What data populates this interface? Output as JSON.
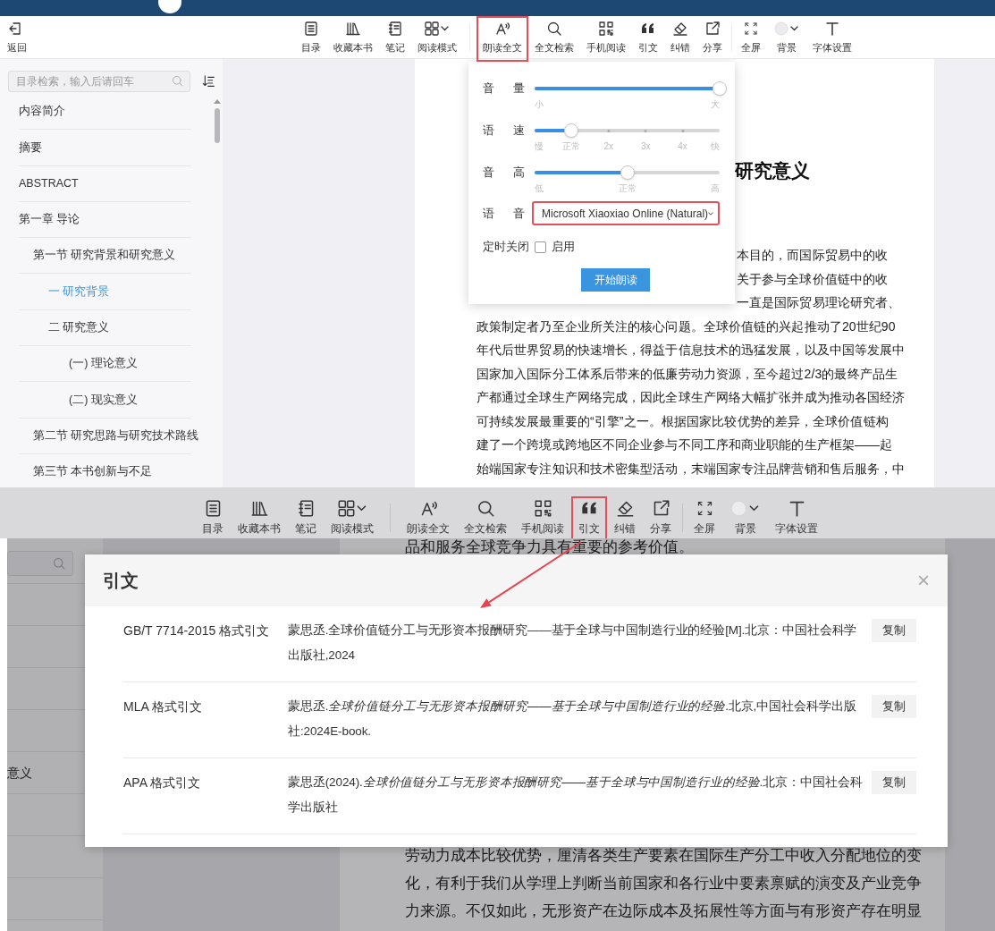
{
  "top_view": {
    "back_button": {
      "label": "返回"
    },
    "toolbar": {
      "groups": [
        [
          {
            "label": "目录",
            "highlighted": false
          },
          {
            "label": "收藏本书",
            "highlighted": false
          },
          {
            "label": "笔记",
            "highlighted": false
          },
          {
            "label": "阅读模式",
            "highlighted": false
          }
        ],
        [
          {
            "label": "朗读全文",
            "highlighted": true
          },
          {
            "label": "全文检索",
            "highlighted": false
          },
          {
            "label": "手机阅读",
            "highlighted": false
          },
          {
            "label": "引文",
            "highlighted": false
          },
          {
            "label": "纠错",
            "highlighted": false
          },
          {
            "label": "分享",
            "highlighted": false
          }
        ],
        [
          {
            "label": "全屏",
            "highlighted": false
          },
          {
            "label": "背景",
            "highlighted": false
          },
          {
            "label": "字体设置",
            "highlighted": false
          }
        ]
      ]
    },
    "toc_search": {
      "placeholder": "目录检索，输入后请回车"
    },
    "toc": [
      {
        "label": "内容简介",
        "selected": false
      },
      {
        "label": "摘要",
        "selected": false
      },
      {
        "label": "ABSTRACT",
        "selected": false
      },
      {
        "label": "第一章 导论",
        "selected": false,
        "children": [
          {
            "label": "第一节 研究背景和研究意义",
            "selected": false,
            "children": [
              {
                "label": "一 研究背景",
                "selected": true
              },
              {
                "label": "二 研究意义",
                "selected": false,
                "children": [
                  {
                    "label": "(一) 理论意义",
                    "selected": false
                  },
                  {
                    "label": "(二) 现实意义",
                    "selected": false
                  }
                ]
              }
            ]
          },
          {
            "label": "第二节 研究思路与研究技术路线",
            "selected": false
          },
          {
            "label": "第三节 本书创新与不足",
            "selected": false
          }
        ]
      }
    ],
    "page": {
      "heading": "研究意义",
      "line_fragments": [
        "本目的，而国际贸易中的收",
        "关于参与全球价值链中的收",
        "一直是国际贸易理论研究者、"
      ],
      "lines": [
        "政策制定者乃至企业所关注的核心问题。全球价值链的兴起推动了20世纪90",
        "年代后世界贸易的快速增长，得益于信息技术的迅猛发展，以及中国等发展中",
        "国家加入国际分工体系后带来的低廉劳动力资源，至今超过2/3的最终产品生",
        "产都通过全球生产网络完成，因此全球生产网络大幅扩张并成为推动各国经济",
        "可持续发展最重要的“引擎”之一。根据国家比较优势的差异，全球价值链构",
        "建了一个跨境或跨地区不同企业参与不同工序和商业职能的生产框架——起",
        "始端国家专注知识和技术密集型活动，末端国家专注品牌营销和售后服务，中"
      ]
    },
    "read_aloud_panel": {
      "sliders": [
        {
          "label": "音 量",
          "kind": "continuous",
          "level": 1,
          "marks": [
            "小",
            "大"
          ]
        },
        {
          "label": "语 速",
          "kind": "stepped",
          "level": 0.2,
          "marks": [
            "慢",
            "正常",
            "2x",
            "3x",
            "4x",
            "快"
          ]
        },
        {
          "label": "音 高",
          "kind": "continuous",
          "level": 0.5,
          "marks": [
            "低",
            "正常",
            "高"
          ]
        }
      ],
      "voice": {
        "label": "语 音",
        "value": "Microsoft Xiaoxiao Online (Natural)",
        "highlighted": true
      },
      "timer": {
        "label": "定时关闭",
        "option": "启用",
        "checked": false
      },
      "start_button": "开始朗读"
    }
  },
  "bottom_view": {
    "toolbar": {
      "groups": [
        [
          {
            "label": "目录",
            "highlighted": false
          },
          {
            "label": "收藏本书",
            "highlighted": false
          },
          {
            "label": "笔记",
            "highlighted": false
          },
          {
            "label": "阅读模式",
            "highlighted": false
          }
        ],
        [
          {
            "label": "朗读全文",
            "highlighted": false
          },
          {
            "label": "全文检索",
            "highlighted": false
          },
          {
            "label": "手机阅读",
            "highlighted": false
          },
          {
            "label": "引文",
            "highlighted": true
          },
          {
            "label": "纠错",
            "highlighted": false
          },
          {
            "label": "分享",
            "highlighted": false
          }
        ],
        [
          {
            "label": "全屏",
            "highlighted": false
          },
          {
            "label": "背景",
            "highlighted": false
          },
          {
            "label": "字体设置",
            "highlighted": false
          }
        ]
      ]
    },
    "toc_fragment": "意义",
    "page_lines_above": [
      "品和服务全球竞争力具有重要的参考价值。"
    ],
    "page_lines_below": [
      "劳动力成本比较优势，厘清各类生产要素在国际生产分工中收入分配地位的变",
      "化，有利于我们从学理上判断当前国家和各行业中要素禀赋的演变及产业竞争",
      "力来源。不仅如此，无形资产在边际成本及拓展性等方面与有形资产存在明显"
    ],
    "citation_dialog": {
      "title": "引文",
      "close": "×",
      "rows": [
        {
          "format": "GB/T 7714-2015 格式引文",
          "text": "蒙思丞.全球价值链分工与无形资本报酬研究——基于全球与中国制造行业的经验[M].北京：中国社会科学出版社,2024",
          "copy": "复制"
        },
        {
          "format": "MLA 格式引文",
          "text": "蒙思丞.*全球价值链分工与无形资本报酬研究——基于全球与中国制造行业的经验*.北京,中国社会科学出版社:2024E-book.",
          "copy": "复制"
        },
        {
          "format": "APA 格式引文",
          "text": "蒙思丞(2024).*全球价值链分工与无形资本报酬研究——基于全球与中国制造行业的经验*.北京：中国社会科学出版社",
          "copy": "复制"
        }
      ]
    }
  }
}
